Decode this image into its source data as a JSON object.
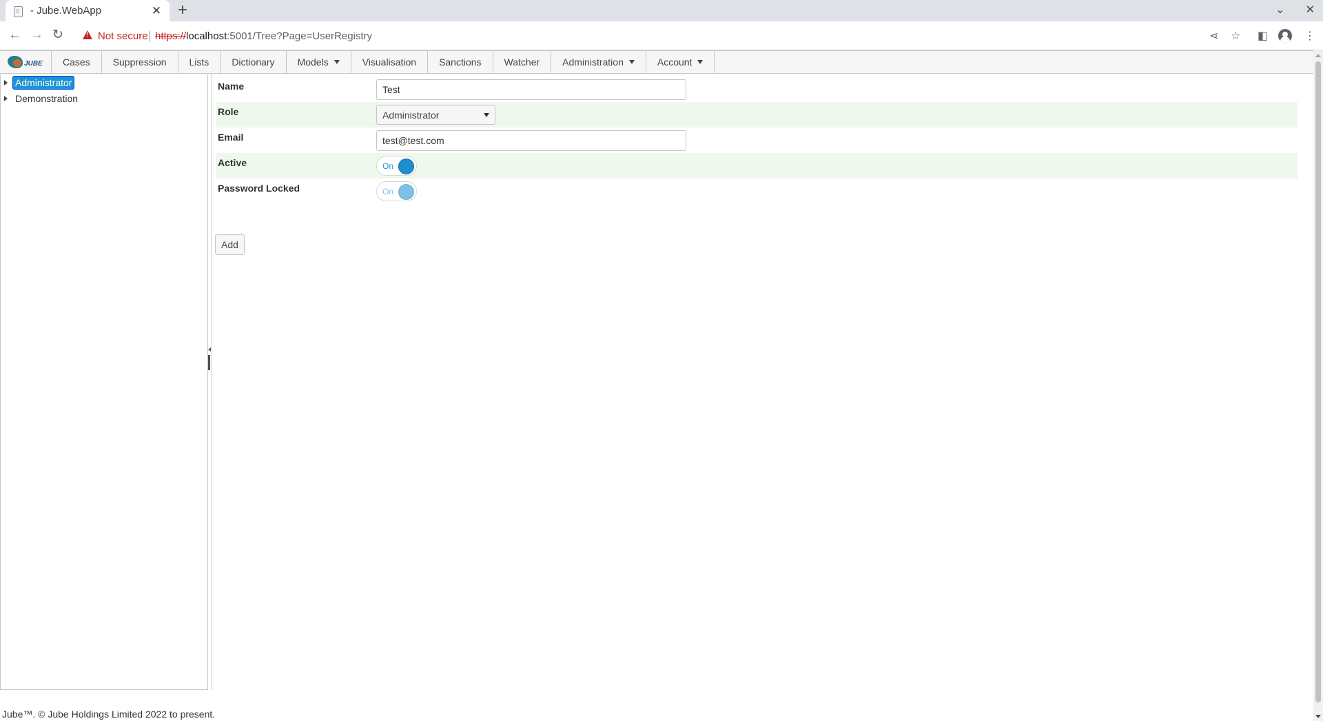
{
  "browser": {
    "tab_title": "- Jube.WebApp",
    "tab_close": "✕",
    "new_tab": "+",
    "not_secure": "Not secure",
    "url_scheme": "https://",
    "url_host": "localhost",
    "url_path": ":5001/Tree?Page=UserRegistry"
  },
  "app": {
    "logo_text": "JUBE",
    "menu": [
      {
        "label": "Cases",
        "dropdown": false
      },
      {
        "label": "Suppression",
        "dropdown": false
      },
      {
        "label": "Lists",
        "dropdown": false
      },
      {
        "label": "Dictionary",
        "dropdown": false
      },
      {
        "label": "Models",
        "dropdown": true
      },
      {
        "label": "Visualisation",
        "dropdown": false
      },
      {
        "label": "Sanctions",
        "dropdown": false
      },
      {
        "label": "Watcher",
        "dropdown": false
      },
      {
        "label": "Administration",
        "dropdown": true
      },
      {
        "label": "Account",
        "dropdown": true
      }
    ],
    "tree": [
      {
        "label": "Administrator",
        "selected": true
      },
      {
        "label": "Demonstration",
        "selected": false
      }
    ],
    "form": {
      "name_label": "Name",
      "name_value": "Test",
      "role_label": "Role",
      "role_value": "Administrator",
      "email_label": "Email",
      "email_value": "test@test.com",
      "active_label": "Active",
      "active_toggle": "On",
      "password_locked_label": "Password Locked",
      "password_locked_toggle": "On",
      "add_button": "Add"
    },
    "footer": "Jube™. © Jube Holdings Limited 2022 to present."
  },
  "colors": {
    "accent": "#1c94d2",
    "alt_row": "#eff8ec",
    "not_secure": "#c5221f"
  }
}
